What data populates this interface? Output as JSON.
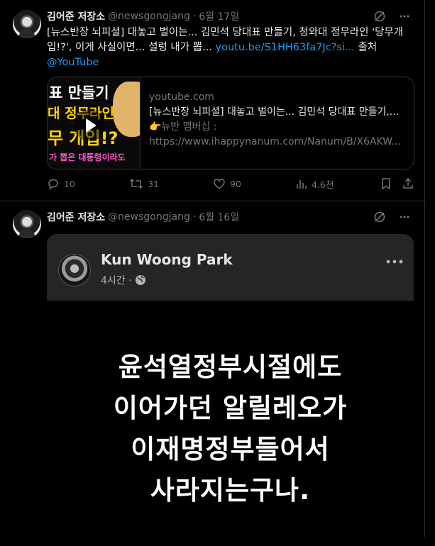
{
  "tweets": [
    {
      "author_name": "김어준 저장소",
      "handle": "@newsgongjang",
      "separator": "·",
      "date": "6월 17일",
      "text_prefix": "[뉴스반장 뇌피셜] 대놓고 벌이는... 김민석 당대표 만들기, 청와대 정무라인 '당무개입!?', 이게 사실이면... 설렁 내가 뽑... ",
      "text_link": "youtu.be/S1HH63fa7Jc?si...",
      "text_suffix": " 출처",
      "mention": "@YouTube",
      "card": {
        "thumb_line1": "표 만들기",
        "thumb_line2": "대 정무라인",
        "thumb_line3": "무 개입!?",
        "thumb_line4": "가 뽑은 대통령이라도",
        "domain": "youtube.com",
        "title": "[뉴스반장 뇌피셜] 대놓고 벌이는... 김민석 당대표 만들기,...",
        "desc1": "👉뉴반 멤버십 :",
        "desc2": "https://www.ihappynanum.com/Nanum/B/X6AKW..."
      },
      "stats": {
        "replies": "10",
        "retweets": "31",
        "likes": "90",
        "views": "4.6천"
      }
    },
    {
      "author_name": "김어준 저장소",
      "handle": "@newsgongjang",
      "separator": "·",
      "date": "6월 16일",
      "fb": {
        "name": "Kun Woong Park",
        "time": "4시간 ·",
        "lines": [
          "윤석열정부시절에도",
          "이어가던 알릴레오가",
          "이재명정부들어서",
          "사라지는구나."
        ]
      }
    }
  ],
  "icons": [
    "grok-icon",
    "more-icon",
    "reply-icon",
    "retweet-icon",
    "like-icon",
    "views-icon",
    "bookmark-icon",
    "share-icon",
    "globe-icon",
    "play-icon"
  ],
  "colors": {
    "background": "#000000",
    "text": "#e7e9ea",
    "muted": "#71767b",
    "link": "#1d9bf0",
    "border": "#2f3336",
    "fb_card": "#252526"
  }
}
